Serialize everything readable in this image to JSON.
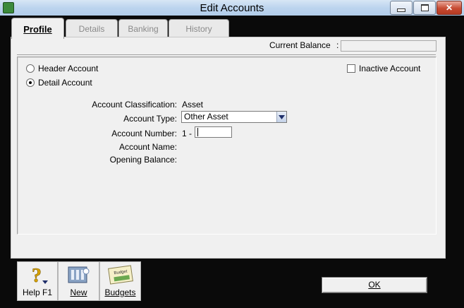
{
  "window": {
    "title": "Edit Accounts",
    "minimize_glyph": "▭",
    "maximize_glyph": "□",
    "close_glyph": "✕"
  },
  "tabs": [
    {
      "label": "Profile",
      "active": true
    },
    {
      "label": "Details",
      "active": false
    },
    {
      "label": "Banking",
      "active": false
    },
    {
      "label": "History",
      "active": false
    }
  ],
  "profile": {
    "current_balance_label": "Current Balance",
    "current_balance_colon": ":",
    "current_balance_value": "",
    "header_account_label": "Header Account",
    "detail_account_label": "Detail Account",
    "selected_account_kind": "detail",
    "inactive_account_label": "Inactive Account",
    "inactive_checked": false,
    "classification_label": "Account Classification:",
    "classification_value": "Asset",
    "type_label": "Account Type:",
    "type_value": "Other Asset",
    "number_label": "Account Number:",
    "number_prefix": "1 -",
    "number_value": "",
    "name_label": "Account Name:",
    "opening_balance_label": "Opening Balance:"
  },
  "toolbar": {
    "help_label": "Help F1",
    "new_label": "New",
    "budgets_label": "Budgets",
    "budget_icon_text": "Budget"
  },
  "ok_label": "OK",
  "colors": {
    "frame": "#0a0a0a",
    "panel": "#f0f0f0",
    "title_bar": "#bcd4ee",
    "close_button": "#c74a32"
  }
}
